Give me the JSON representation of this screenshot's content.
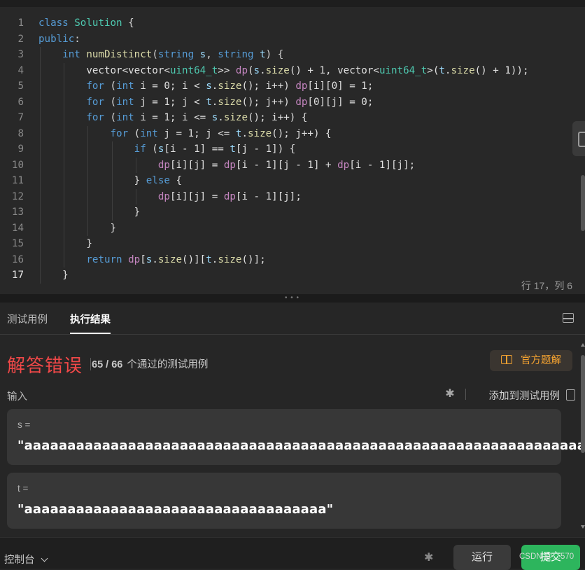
{
  "editor": {
    "lines": [
      {
        "n": "1",
        "indent": 0,
        "tokens": [
          [
            "kw",
            "class"
          ],
          [
            "pl",
            " "
          ],
          [
            "ty",
            "Solution"
          ],
          [
            "pl",
            " {"
          ]
        ]
      },
      {
        "n": "2",
        "indent": 0,
        "tokens": [
          [
            "kw",
            "public"
          ],
          [
            "pl",
            ":"
          ]
        ]
      },
      {
        "n": "3",
        "indent": 1,
        "tokens": [
          [
            "kw",
            "int"
          ],
          [
            "pl",
            " "
          ],
          [
            "fn",
            "numDistinct"
          ],
          [
            "pl",
            "("
          ],
          [
            "kw",
            "string"
          ],
          [
            "pl",
            " "
          ],
          [
            "var",
            "s"
          ],
          [
            "pl",
            ", "
          ],
          [
            "kw",
            "string"
          ],
          [
            "pl",
            " "
          ],
          [
            "var",
            "t"
          ],
          [
            "pl",
            ") {"
          ]
        ]
      },
      {
        "n": "4",
        "indent": 2,
        "tokens": [
          [
            "ws",
            "vector<vector<"
          ],
          [
            "ty",
            "uint64_t"
          ],
          [
            "ws",
            ">> "
          ],
          [
            "pk",
            "dp"
          ],
          [
            "ws",
            "("
          ],
          [
            "var",
            "s"
          ],
          [
            "ws",
            "."
          ],
          [
            "fn",
            "size"
          ],
          [
            "ws",
            "() + 1, vector<"
          ],
          [
            "ty",
            "uint64_t"
          ],
          [
            "ws",
            ">("
          ],
          [
            "var",
            "t"
          ],
          [
            "ws",
            "."
          ],
          [
            "fn",
            "size"
          ],
          [
            "ws",
            "() + 1));"
          ]
        ]
      },
      {
        "n": "5",
        "indent": 2,
        "tokens": [
          [
            "kw",
            "for"
          ],
          [
            "ws",
            " ("
          ],
          [
            "kw",
            "int"
          ],
          [
            "ws",
            " i = 0; i < "
          ],
          [
            "var",
            "s"
          ],
          [
            "ws",
            "."
          ],
          [
            "fn",
            "size"
          ],
          [
            "ws",
            "(); i++) "
          ],
          [
            "pk",
            "dp"
          ],
          [
            "ws",
            "[i][0] = 1;"
          ]
        ]
      },
      {
        "n": "6",
        "indent": 2,
        "tokens": [
          [
            "kw",
            "for"
          ],
          [
            "ws",
            " ("
          ],
          [
            "kw",
            "int"
          ],
          [
            "ws",
            " j = 1; j < "
          ],
          [
            "var",
            "t"
          ],
          [
            "ws",
            "."
          ],
          [
            "fn",
            "size"
          ],
          [
            "ws",
            "(); j++) "
          ],
          [
            "pk",
            "dp"
          ],
          [
            "ws",
            "[0][j] = 0;"
          ]
        ]
      },
      {
        "n": "7",
        "indent": 2,
        "tokens": [
          [
            "kw",
            "for"
          ],
          [
            "ws",
            " ("
          ],
          [
            "kw",
            "int"
          ],
          [
            "ws",
            " i = 1; i <= "
          ],
          [
            "var",
            "s"
          ],
          [
            "ws",
            "."
          ],
          [
            "fn",
            "size"
          ],
          [
            "ws",
            "(); i++) {"
          ]
        ]
      },
      {
        "n": "8",
        "indent": 3,
        "tokens": [
          [
            "kw",
            "for"
          ],
          [
            "ws",
            " ("
          ],
          [
            "kw",
            "int"
          ],
          [
            "ws",
            " j = 1; j <= "
          ],
          [
            "var",
            "t"
          ],
          [
            "ws",
            "."
          ],
          [
            "fn",
            "size"
          ],
          [
            "ws",
            "(); j++) {"
          ]
        ]
      },
      {
        "n": "9",
        "indent": 4,
        "tokens": [
          [
            "kw",
            "if"
          ],
          [
            "ws",
            " ("
          ],
          [
            "var",
            "s"
          ],
          [
            "ws",
            "[i - 1] == "
          ],
          [
            "var",
            "t"
          ],
          [
            "ws",
            "[j - 1]) {"
          ]
        ]
      },
      {
        "n": "10",
        "indent": 5,
        "tokens": [
          [
            "pk",
            "dp"
          ],
          [
            "ws",
            "[i][j] = "
          ],
          [
            "pk",
            "dp"
          ],
          [
            "ws",
            "[i - 1][j - 1] + "
          ],
          [
            "pk",
            "dp"
          ],
          [
            "ws",
            "[i - 1][j];"
          ]
        ]
      },
      {
        "n": "11",
        "indent": 4,
        "tokens": [
          [
            "ws",
            "} "
          ],
          [
            "kw",
            "else"
          ],
          [
            "ws",
            " {"
          ]
        ]
      },
      {
        "n": "12",
        "indent": 5,
        "tokens": [
          [
            "pk",
            "dp"
          ],
          [
            "ws",
            "[i][j] = "
          ],
          [
            "pk",
            "dp"
          ],
          [
            "ws",
            "[i - 1][j];"
          ]
        ]
      },
      {
        "n": "13",
        "indent": 4,
        "tokens": [
          [
            "ws",
            "}"
          ]
        ]
      },
      {
        "n": "14",
        "indent": 3,
        "tokens": [
          [
            "ws",
            "}"
          ]
        ]
      },
      {
        "n": "15",
        "indent": 2,
        "tokens": [
          [
            "ws",
            "}"
          ]
        ]
      },
      {
        "n": "16",
        "indent": 2,
        "tokens": [
          [
            "kw",
            "return"
          ],
          [
            "ws",
            " "
          ],
          [
            "pk",
            "dp"
          ],
          [
            "ws",
            "["
          ],
          [
            "var",
            "s"
          ],
          [
            "ws",
            "."
          ],
          [
            "fn",
            "size"
          ],
          [
            "ws",
            "()]["
          ],
          [
            "var",
            "t"
          ],
          [
            "ws",
            "."
          ],
          [
            "fn",
            "size"
          ],
          [
            "ws",
            "()];"
          ]
        ]
      },
      {
        "n": "17",
        "indent": 1,
        "active": true,
        "tokens": [
          [
            "ws",
            "}"
          ]
        ]
      }
    ],
    "cursor_position": "行 17，列 6"
  },
  "panel": {
    "tab_testcases": "测试用例",
    "tab_results": "执行结果",
    "result_title": "解答错误",
    "passed_count": "65 / 66",
    "passed_label": "个通过的测试用例",
    "official_solution_label": "官方题解",
    "input_label": "输入",
    "add_to_testcases_label": "添加到测试用例",
    "inputs": [
      {
        "name": "s =",
        "value": "\"aaaaaaaaaaaaaaaaaaaaaaaaaaaaaaaaaaaaaaaaaaaaaaaaaaaaaaaaaaaaaaaaaa\""
      },
      {
        "name": "t =",
        "value": "\"aaaaaaaaaaaaaaaaaaaaaaaaaaaaaaaaaaa\""
      }
    ]
  },
  "footer": {
    "console_label": "控制台",
    "run_label": "运行",
    "submit_label": "提交",
    "watermark": "CSDN @…570"
  },
  "colors": {
    "error_red": "#f04848",
    "official_orange": "#f0a030",
    "submit_green": "#2db55d"
  },
  "icons": [
    "bug-icon",
    "book-icon",
    "document-icon",
    "layout-icon",
    "chevron-down-icon"
  ]
}
